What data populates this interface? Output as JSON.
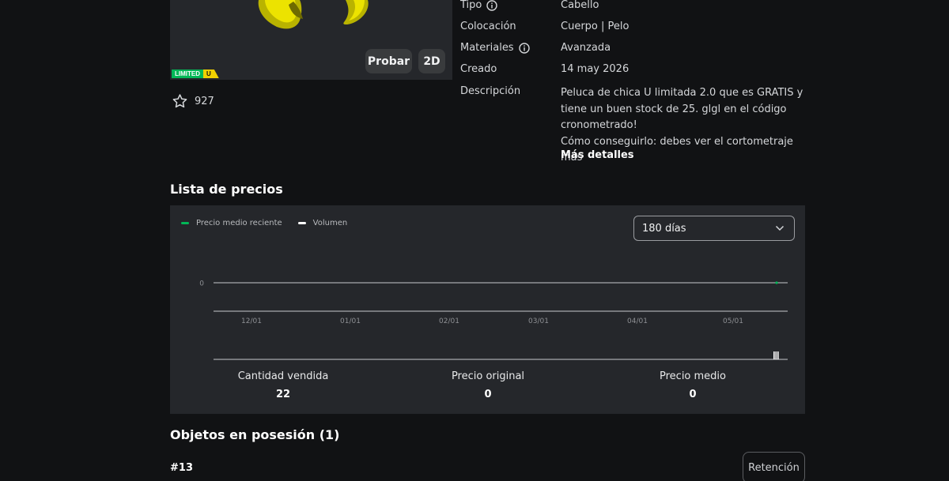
{
  "item": {
    "try_label": "Probar",
    "view_2d_label": "2D",
    "limited_label": "LIMITED",
    "limited_u_label": "U",
    "favorites_count": "927"
  },
  "details": [
    {
      "label": "Tipo",
      "value": "Cabello",
      "info": true
    },
    {
      "label": "Colocación",
      "value": "Cuerpo | Pelo",
      "info": false
    },
    {
      "label": "Materiales",
      "value": "Avanzada",
      "info": true
    },
    {
      "label": "Creado",
      "value": "14 may 2026",
      "info": false
    }
  ],
  "description": {
    "label": "Descripción",
    "text": "Peluca de chica U limitada 2.0 que es GRATIS y tiene un buen stock de 25. glgl en el código cronometrado!\nCómo conseguirlo: debes ver el cortometraje más",
    "more_label": "Más detalles"
  },
  "price_section": {
    "title": "Lista de precios",
    "legend": [
      {
        "name": "Precio medio reciente",
        "color": "#02b757"
      },
      {
        "name": "Volumen",
        "color": "#ffffff"
      }
    ],
    "period": "180 días"
  },
  "chart_data": {
    "type": "line",
    "x": [
      "12/01",
      "01/01",
      "02/01",
      "03/01",
      "04/01",
      "05/01"
    ],
    "y_ticks": [
      "0"
    ],
    "series": [
      {
        "name": "Precio medio reciente",
        "values": [
          0,
          0,
          0,
          0,
          0,
          0
        ],
        "color": "#02b757"
      },
      {
        "name": "Volumen",
        "values": [
          0,
          0,
          0,
          0,
          0,
          22
        ],
        "color": "#ffffff"
      }
    ],
    "grid": true,
    "legend": "top-left"
  },
  "stats": [
    {
      "label": "Cantidad vendida",
      "value": "22"
    },
    {
      "label": "Precio original",
      "value": "0"
    },
    {
      "label": "Precio medio",
      "value": "0"
    }
  ],
  "owned": {
    "title": "Objetos en posesión (1)",
    "serial": "#13",
    "hold_label": "Retención"
  },
  "colors": {
    "background": "#111214",
    "panel": "#25272b",
    "accent_green": "#02b757",
    "limited_yellow": "#f0d000"
  }
}
